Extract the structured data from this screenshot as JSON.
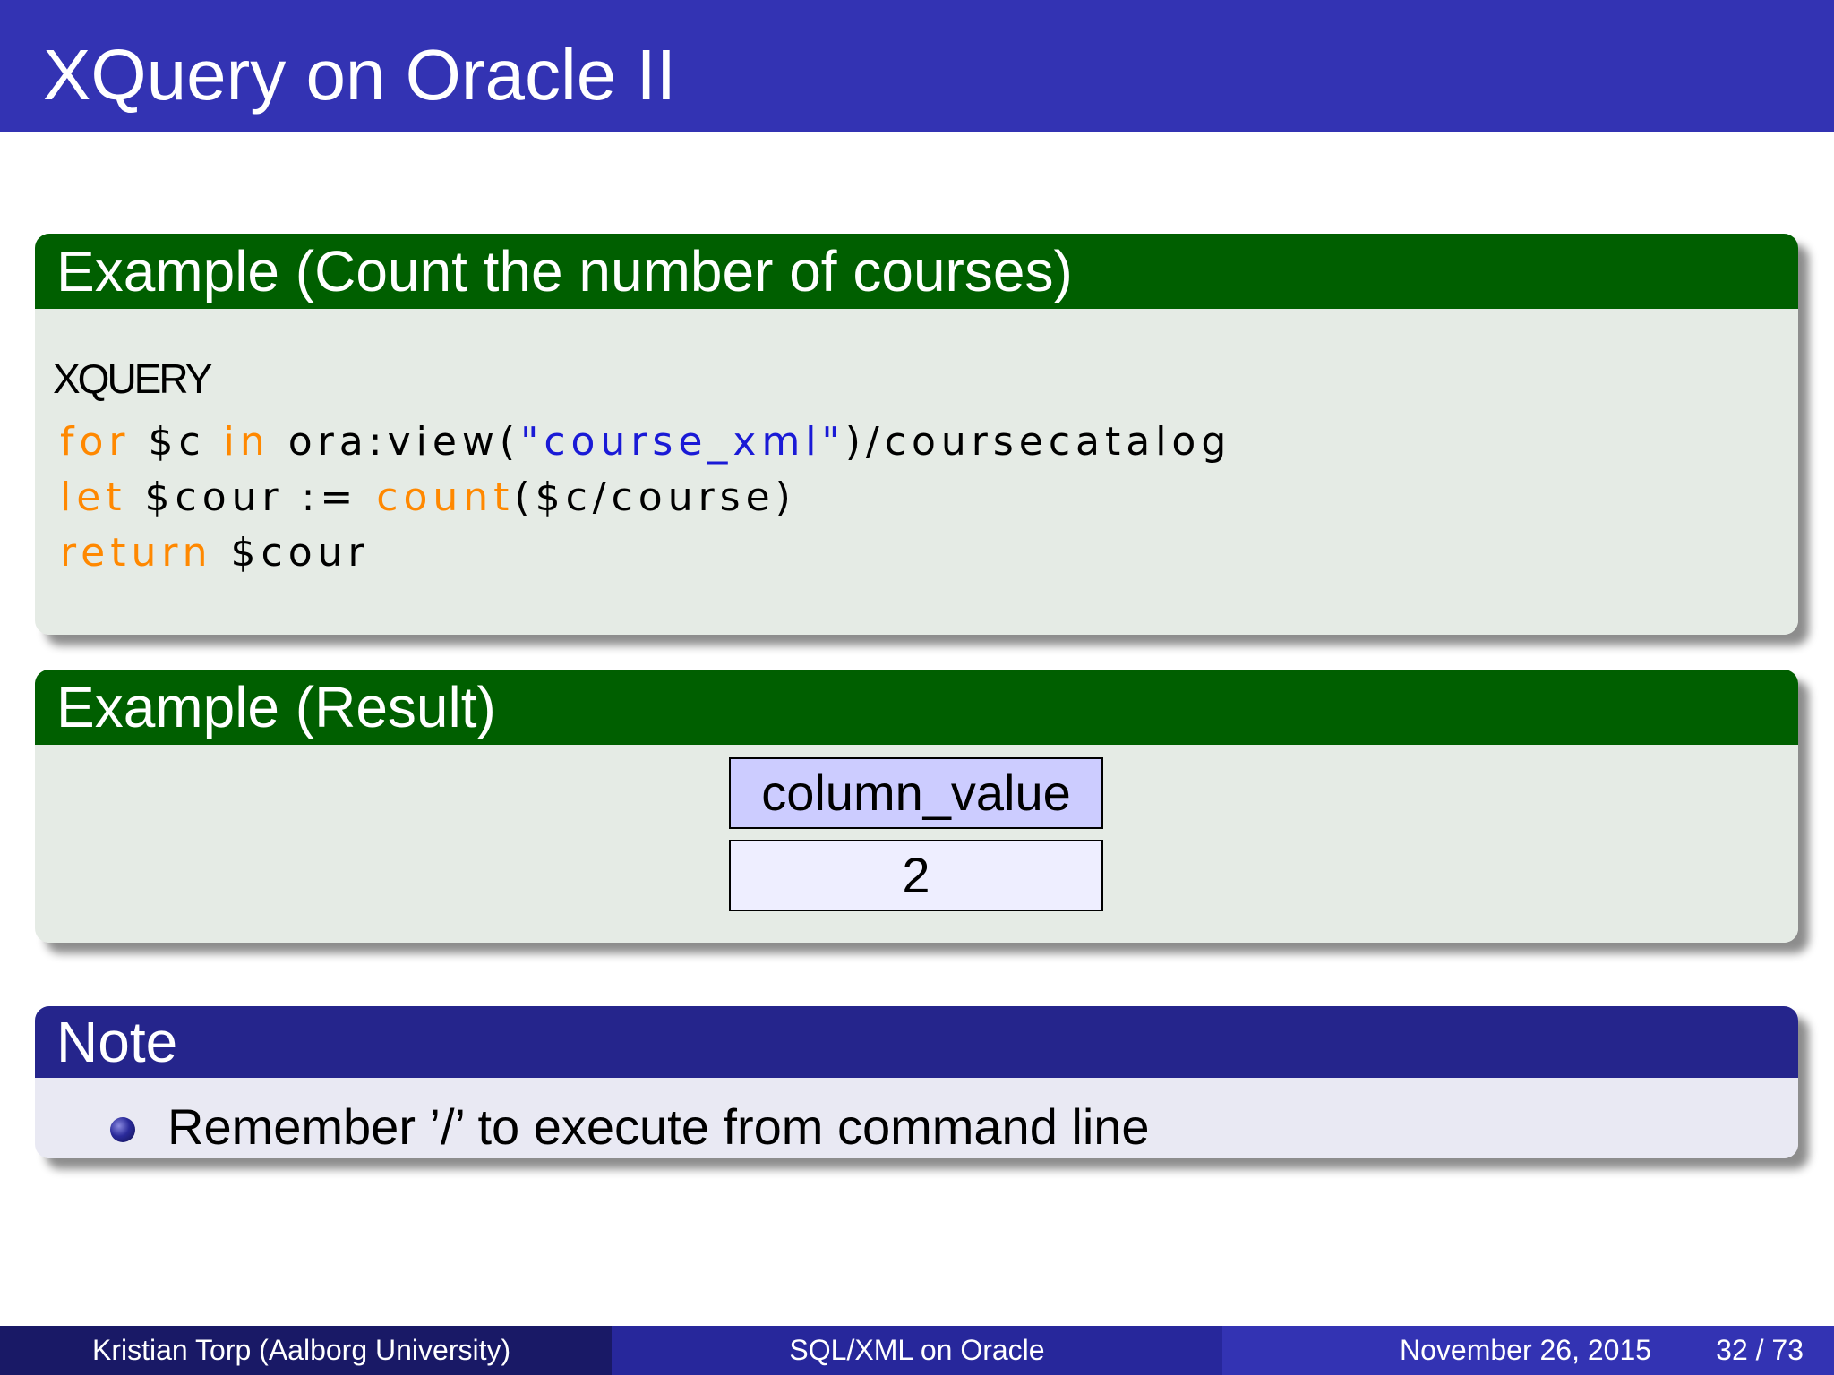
{
  "slide": {
    "title": "XQuery on Oracle II"
  },
  "example_query": {
    "header": "Example (Count the number of courses)",
    "keyword": "XQUERY",
    "line1": {
      "kw_for": "for",
      "var_c": " $c ",
      "kw_in": "in",
      "call_open": " ora:view(",
      "string": "\"course_xml\"",
      "call_close": ")/coursecatalog"
    },
    "line2": {
      "kw_let": "let",
      "assign": " $cour := ",
      "fn_count": "count",
      "args": "($c/course)"
    },
    "line3": {
      "kw_return": "return",
      "var": " $cour"
    }
  },
  "example_result": {
    "header": "Example (Result)",
    "column_header": "column_value",
    "value": "2"
  },
  "note": {
    "header": "Note",
    "items": [
      "Remember ’/’ to execute from command line"
    ]
  },
  "footer": {
    "author": "Kristian Torp  (Aalborg University)",
    "title": "SQL/XML on Oracle",
    "date": "November 26, 2015",
    "pages": "32 / 73"
  },
  "colors": {
    "title_bar": "#3333b3",
    "example_header": "#005f00",
    "example_body": "#e5ebe5",
    "note_header": "#25258c",
    "note_body": "#e9e9f3",
    "code_keyword": "#ff8800",
    "code_string": "#1a1ad6",
    "table_header": "#ccccff",
    "table_cell": "#eeeeff",
    "footer_left": "#191966",
    "footer_middle": "#27279b",
    "footer_right": "#3333b3"
  }
}
